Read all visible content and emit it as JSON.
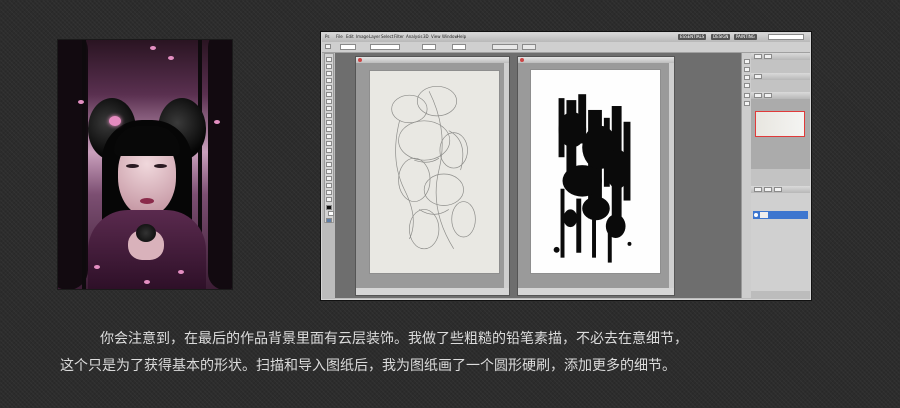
{
  "caption": {
    "line1": "你会注意到，在最后的作品背景里面有云层装饰。我做了些粗糙的铅笔素描，不必去在意细节，",
    "line2": "这个只是为了获得基本的形状。扫描和导入图纸后，我为图纸画了一个圆形硬刷，添加更多的细节。"
  },
  "photoshop": {
    "menus": [
      "Ps",
      "File",
      "Edit",
      "Image",
      "Layer",
      "Select",
      "Filter",
      "Analysis",
      "3D",
      "View",
      "Window",
      "Help"
    ],
    "workspace_buttons": [
      "ESSENTIALS",
      "DESIGN",
      "PAINTING"
    ]
  },
  "colors": {
    "page_background": "#2c2c2c",
    "caption_text": "#dcdcdc",
    "selected_layer": "#3d76cf",
    "navigator_view_box": "#e03a3a"
  },
  "icons": [
    "close-icon",
    "eye-icon"
  ]
}
